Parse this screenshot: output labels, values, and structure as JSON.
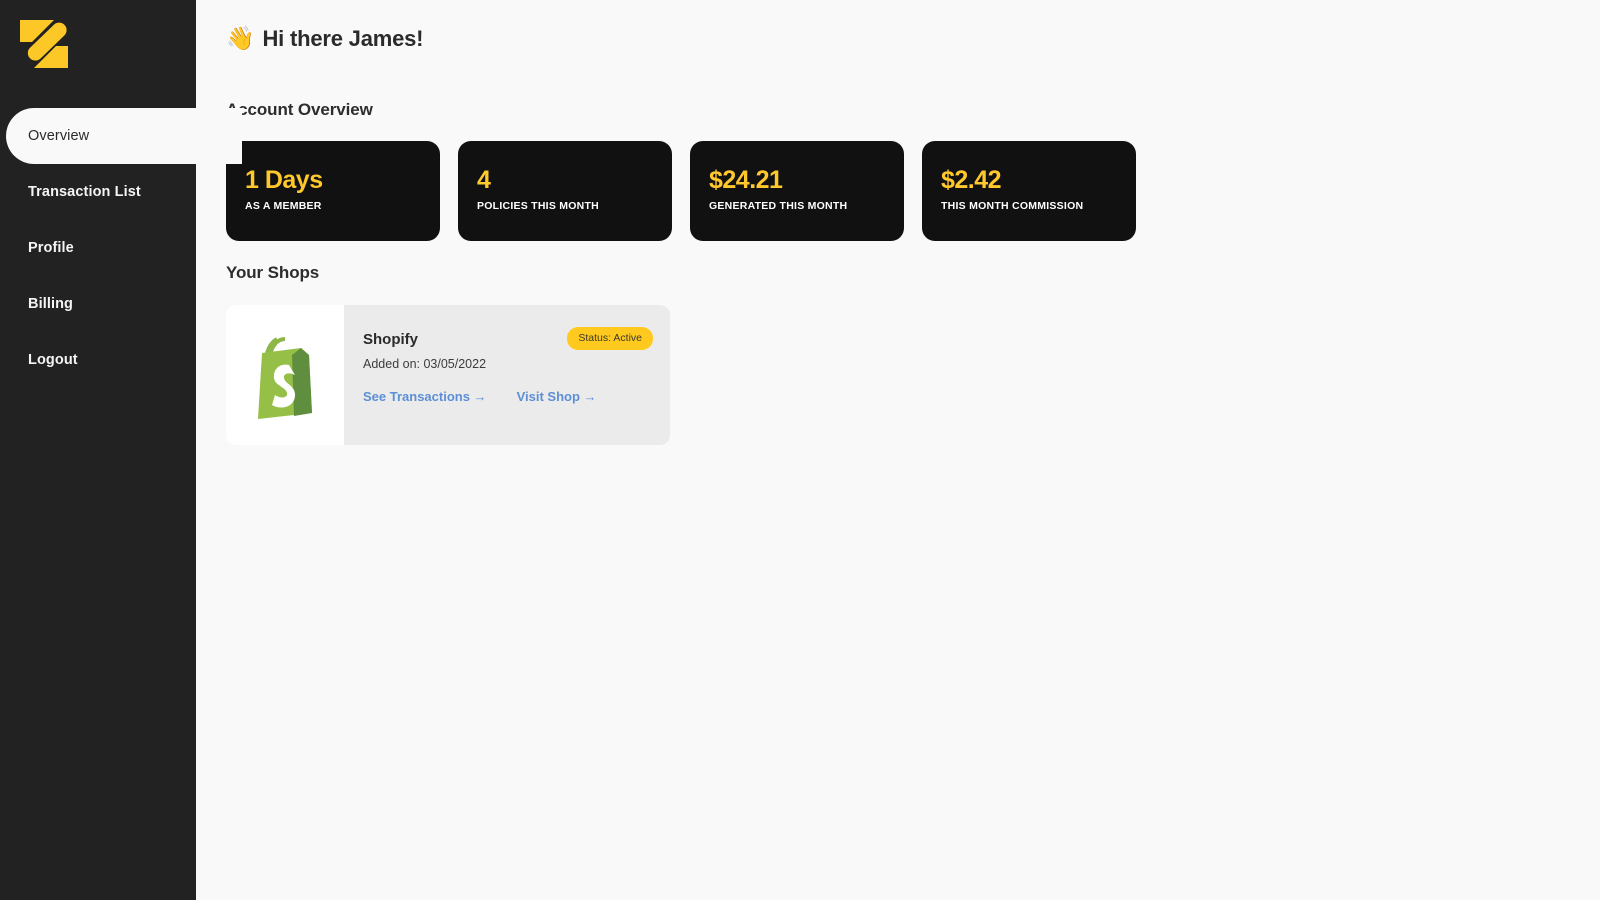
{
  "brand": {
    "logo_icon": "stylized-s-logo",
    "accent_color": "#ffc82c",
    "sidebar_color": "#222222"
  },
  "sidebar": {
    "items": [
      {
        "label": "Overview",
        "name": "overview",
        "active": true
      },
      {
        "label": "Transaction List",
        "name": "transaction-list",
        "active": false
      },
      {
        "label": "Profile",
        "name": "profile",
        "active": false
      },
      {
        "label": "Billing",
        "name": "billing",
        "active": false
      },
      {
        "label": "Logout",
        "name": "logout",
        "active": false
      }
    ]
  },
  "header": {
    "wave_emoji": "👋",
    "greeting": "Hi there James!"
  },
  "account_overview": {
    "title": "Account Overview",
    "cards": [
      {
        "value": "1 Days",
        "label": "AS A MEMBER"
      },
      {
        "value": "4",
        "label": "POLICIES THIS MONTH"
      },
      {
        "value": "$24.21",
        "label": "GENERATED THIS MONTH"
      },
      {
        "value": "$2.42",
        "label": "THIS MONTH COMMISSION"
      }
    ]
  },
  "your_shops": {
    "title": "Your Shops",
    "shops": [
      {
        "name": "Shopify",
        "logo_icon": "shopify-bag-icon",
        "added_on": "Added on: 03/05/2022",
        "status_badge": "Status: Active",
        "status_color": "#ffc91d",
        "links": [
          {
            "label": "See Transactions →",
            "name": "see-transactions"
          },
          {
            "label": "Visit Shop →",
            "name": "visit-shop"
          }
        ]
      }
    ]
  }
}
